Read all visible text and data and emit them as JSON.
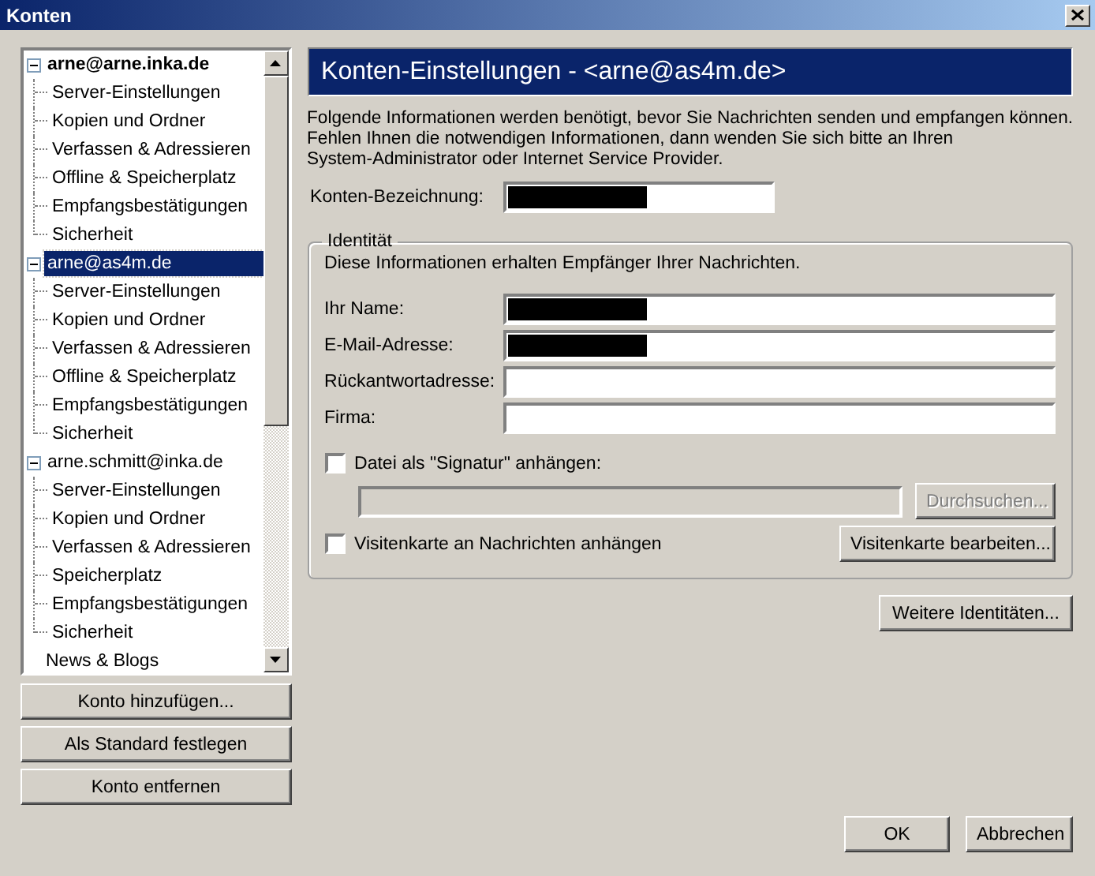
{
  "window": {
    "title": "Konten"
  },
  "accounts": [
    {
      "kind": "account",
      "name": "arne@arne.inka.de",
      "default": true,
      "selected": false,
      "expanded": true,
      "children": [
        {
          "label": "Server-Einstellungen",
          "selected": false
        },
        {
          "label": "Kopien und Ordner",
          "selected": false
        },
        {
          "label": "Verfassen & Adressieren",
          "selected": false
        },
        {
          "label": "Offline & Speicherplatz",
          "selected": false
        },
        {
          "label": "Empfangsbestätigungen",
          "selected": false
        },
        {
          "label": "Sicherheit",
          "selected": false
        }
      ]
    },
    {
      "kind": "account",
      "name": "arne@as4m.de",
      "default": false,
      "selected": true,
      "expanded": true,
      "children": [
        {
          "label": "Server-Einstellungen",
          "selected": false
        },
        {
          "label": "Kopien und Ordner",
          "selected": false
        },
        {
          "label": "Verfassen & Adressieren",
          "selected": false
        },
        {
          "label": "Offline & Speicherplatz",
          "selected": false
        },
        {
          "label": "Empfangsbestätigungen",
          "selected": false
        },
        {
          "label": "Sicherheit",
          "selected": false
        }
      ]
    },
    {
      "kind": "account",
      "name": "arne.schmitt@inka.de",
      "default": false,
      "selected": false,
      "expanded": true,
      "children": [
        {
          "label": "Server-Einstellungen",
          "selected": false
        },
        {
          "label": "Kopien und Ordner",
          "selected": false
        },
        {
          "label": "Verfassen & Adressieren",
          "selected": false
        },
        {
          "label": "Speicherplatz",
          "selected": false
        },
        {
          "label": "Empfangsbestätigungen",
          "selected": false
        },
        {
          "label": "Sicherheit",
          "selected": false
        }
      ]
    },
    {
      "kind": "plain",
      "name": "News & Blogs",
      "default": false,
      "selected": false
    }
  ],
  "account_buttons": [
    "Konto hinzufügen...",
    "Als Standard festlegen",
    "Konto entfernen"
  ],
  "panel": {
    "title": "Konten-Einstellungen - <arne@as4m.de>",
    "description_lines": [
      "Folgende Informationen werden benötigt, bevor Sie Nachrichten senden und empfangen können.",
      "Fehlen Ihnen die notwendigen Informationen, dann wenden Sie sich bitte an Ihren",
      "System-Administrator oder Internet Service Provider."
    ],
    "account_name": {
      "label": "Konten-Bezeichnung:",
      "redacted": true
    },
    "identity": {
      "legend": "Identität",
      "hint": "Diese Informationen erhalten Empfänger Ihrer Nachrichten.",
      "fields": [
        {
          "label": "Ihr Name:",
          "redacted": true
        },
        {
          "label": "E-Mail-Adresse:",
          "redacted": true
        },
        {
          "label": "Rückantwortadresse:",
          "redacted": false
        },
        {
          "label": "Firma:",
          "redacted": false
        }
      ],
      "signature": {
        "label": "Datei als \"Signatur\" anhängen:",
        "checked": false,
        "browse": "Durchsuchen...",
        "disabled": true
      },
      "vcard": {
        "label": "Visitenkarte an Nachrichten anhängen",
        "checked": false,
        "edit": "Visitenkarte bearbeiten..."
      }
    },
    "more_identities": "Weitere Identitäten..."
  },
  "dialog_buttons": [
    "OK",
    "Abbrechen"
  ]
}
